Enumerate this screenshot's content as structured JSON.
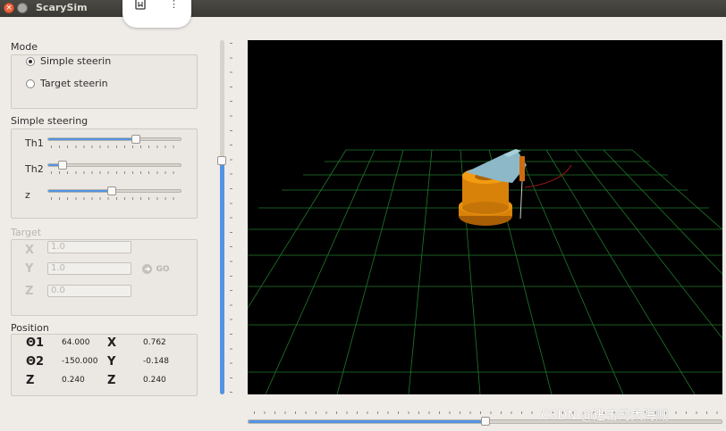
{
  "window": {
    "title": "ScarySim"
  },
  "mode": {
    "heading": "Mode",
    "options": [
      {
        "label": "Simple steerin",
        "selected": true
      },
      {
        "label": "Target steerin",
        "selected": false
      }
    ]
  },
  "simple_steering": {
    "heading": "Simple steering",
    "sliders": [
      {
        "label": "Th1",
        "value_fraction": 0.66
      },
      {
        "label": "Th2",
        "value_fraction": 0.11
      },
      {
        "label": "z",
        "value_fraction": 0.48
      }
    ]
  },
  "target": {
    "heading": "Target",
    "fields": [
      {
        "label": "X",
        "value": "1.0"
      },
      {
        "label": "Y",
        "value": "1.0"
      },
      {
        "label": "Z",
        "value": "0.0"
      }
    ],
    "go_label": "GO"
  },
  "position": {
    "heading": "Position",
    "rows": [
      {
        "joint_label": "Θ1",
        "joint_value": "64.000",
        "coord_label": "X",
        "coord_value": "0.762"
      },
      {
        "joint_label": "Θ2",
        "joint_value": "-150.000",
        "coord_label": "Y",
        "coord_value": "-0.148"
      },
      {
        "joint_label": "Z",
        "joint_value": "0.240",
        "coord_label": "Z",
        "coord_value": "0.240"
      }
    ]
  },
  "view": {
    "vertical_slider_fraction": 0.66,
    "horizontal_slider_fraction": 0.5,
    "grid_color": "#1f7a2a",
    "robot_base_color": "#e08a0c",
    "robot_arm_color": "#8cb8c8"
  },
  "watermark": "CSDN @进击的大海贼"
}
